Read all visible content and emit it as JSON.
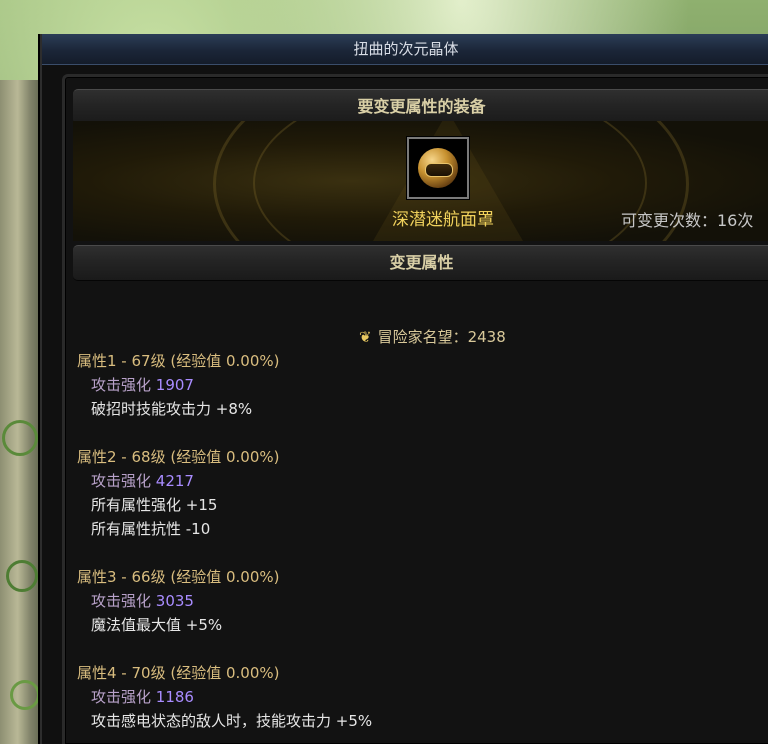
{
  "window": {
    "title": "扭曲的次元晶体"
  },
  "equip_section": {
    "header": "要变更属性的装备",
    "item_name": "深潜迷航面罩",
    "change_count": "可变更次数：16次"
  },
  "change_section": {
    "header": "变更属性"
  },
  "reputation": {
    "label": "冒险家名望：2438"
  },
  "attributes": [
    {
      "title": "属性1 - 67级 (经验值 0.00%)",
      "stat_label": "攻击强化",
      "stat_value": "1907",
      "effects": [
        "破招时技能攻击力 +8%"
      ]
    },
    {
      "title": "属性2 - 68级 (经验值 0.00%)",
      "stat_label": "攻击强化",
      "stat_value": "4217",
      "effects": [
        "所有属性强化 +15",
        "所有属性抗性 -10"
      ]
    },
    {
      "title": "属性3 - 66级 (经验值 0.00%)",
      "stat_label": "攻击强化",
      "stat_value": "3035",
      "effects": [
        "魔法值最大值 +5%"
      ]
    },
    {
      "title": "属性4 - 70级 (经验值 0.00%)",
      "stat_label": "攻击强化",
      "stat_value": "1186",
      "effects": [
        "攻击感电状态的敌人时，技能攻击力 +5%"
      ]
    }
  ],
  "colors": {
    "title_gold": "#d9bd7f",
    "item_name_yellow": "#f0d15c",
    "stat_value_purple": "#a98cff",
    "effect_text": "#e6e6e6"
  },
  "icons": {
    "reputation": "laurel-icon",
    "item": "helmet-icon"
  }
}
